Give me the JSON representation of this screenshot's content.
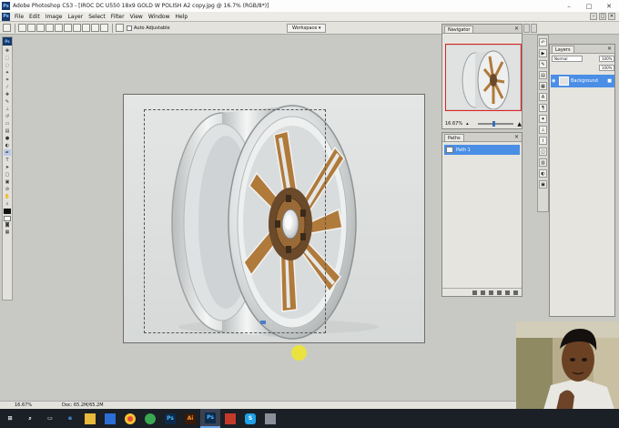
{
  "titlebar": {
    "app_icon_label": "Ps",
    "title": "Adobe Photoshop CS3 - [IROC DC U550 18x9 GOLD W POLISH A2 copy.jpg @ 16.7% (RGB/8*)]",
    "minimize": "–",
    "maximize": "□",
    "close": "✕"
  },
  "menubar": {
    "items": [
      "File",
      "Edit",
      "Image",
      "Layer",
      "Select",
      "Filter",
      "View",
      "Window",
      "Help"
    ]
  },
  "options": {
    "auto_select_label": "Auto Adjustable",
    "workspace_label": "Workspace ▾"
  },
  "navigator": {
    "tab": "Navigator",
    "zoom": "16.67%",
    "view_box_color": "#e02020"
  },
  "paths": {
    "tab": "Paths",
    "items": [
      "Path 1"
    ]
  },
  "layers": {
    "tab": "Layers",
    "blend_mode": "Normal",
    "opacity": "100%",
    "fill": "100%",
    "layer_name": "Background",
    "lock_icon": "lock-icon"
  },
  "status": {
    "zoom": "16.67%",
    "doc_info": "Doc: 65.2M/65.2M"
  },
  "colors": {
    "rim_gold": "#b07a3a",
    "rim_chrome": "#e6e8e8",
    "selection_blue": "#4b8ee6",
    "taskbar": "#1b1f26"
  },
  "taskbar": {
    "items": [
      "windows-icon",
      "search-icon",
      "task-view-icon",
      "edge-icon",
      "file-explorer-icon",
      "store-icon",
      "chrome-icon",
      "app-icon",
      "photoshop-icon",
      "illustrator-icon",
      "photoshop-active-icon",
      "app2-icon",
      "skype-icon",
      "app3-icon"
    ]
  }
}
